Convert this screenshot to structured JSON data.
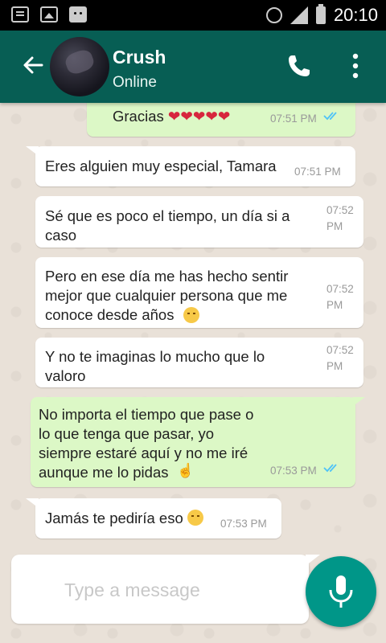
{
  "status_bar": {
    "time": "20:10"
  },
  "header": {
    "contact_name": "Crush",
    "contact_status": "Online"
  },
  "messages": [
    {
      "dir": "out",
      "text": "Gracias",
      "emoji": "hearts",
      "time": "07:51 PM",
      "read": true
    },
    {
      "dir": "in",
      "text": "Eres alguien muy especial, Tamara",
      "time": "07:51 PM"
    },
    {
      "dir": "in",
      "text": "Sé que es poco el tiempo, un día si a caso",
      "time": "07:52 PM"
    },
    {
      "dir": "in",
      "text": "Pero en ese día me has hecho sentir mejor que cualquier persona que me conoce desde años",
      "time": "07:52 PM"
    },
    {
      "dir": "in",
      "text": "Y no te imaginas lo mucho que lo valoro",
      "time": "07:52 PM"
    },
    {
      "dir": "out",
      "text": "No importa el tiempo que pase o lo que tenga que pasar, yo siempre estaré aquí y no me iré aunque me lo pidas",
      "time": "07:53 PM",
      "read": true
    },
    {
      "dir": "in",
      "text": "Jamás te pediría eso",
      "time": "07:53 PM"
    }
  ],
  "composer": {
    "placeholder": "Type a message"
  },
  "colors": {
    "header": "#075e54",
    "outgoing_bubble": "#dcf8c6",
    "incoming_bubble": "#ffffff",
    "read_ticks": "#4fc3f7",
    "fab": "#009688"
  }
}
